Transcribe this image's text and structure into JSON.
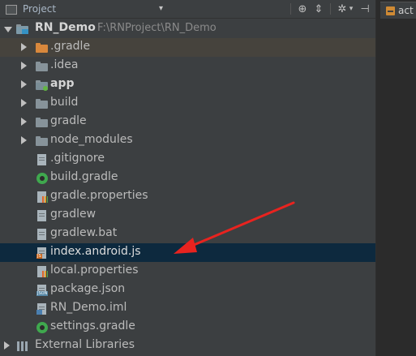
{
  "header": {
    "panel_title": "Project",
    "dropdown_glyph": "▾",
    "tools": [
      {
        "name": "crosshair-icon",
        "glyph": "⊕"
      },
      {
        "name": "collapse-all-icon",
        "glyph": "⇕"
      },
      {
        "name": "settings-gear-icon",
        "glyph": "✲"
      },
      {
        "name": "hide-panel-icon",
        "glyph": "⊣"
      }
    ]
  },
  "editor_tab": {
    "label": "act"
  },
  "tree": {
    "root": {
      "name": "RN_Demo",
      "path": "F:\\RNProject\\RN_Demo"
    },
    "items": [
      {
        "label": ".gradle",
        "kind": "folder-orange"
      },
      {
        "label": ".idea",
        "kind": "folder"
      },
      {
        "label": "app",
        "kind": "module"
      },
      {
        "label": "build",
        "kind": "folder"
      },
      {
        "label": "gradle",
        "kind": "folder"
      },
      {
        "label": "node_modules",
        "kind": "folder"
      },
      {
        "label": ".gitignore",
        "kind": "text-file"
      },
      {
        "label": "build.gradle",
        "kind": "gradle-file"
      },
      {
        "label": "gradle.properties",
        "kind": "properties-file"
      },
      {
        "label": "gradlew",
        "kind": "text-file"
      },
      {
        "label": "gradlew.bat",
        "kind": "text-file"
      },
      {
        "label": "index.android.js",
        "kind": "js-file"
      },
      {
        "label": "local.properties",
        "kind": "properties-file"
      },
      {
        "label": "package.json",
        "kind": "json-file"
      },
      {
        "label": "RN_Demo.iml",
        "kind": "iml-file"
      },
      {
        "label": "settings.gradle",
        "kind": "gradle-file"
      }
    ],
    "external": {
      "label": "External Libraries"
    }
  },
  "colors": {
    "background": "#3c3f41",
    "selection": "#0d293e",
    "annotation_arrow": "#e8231f"
  }
}
